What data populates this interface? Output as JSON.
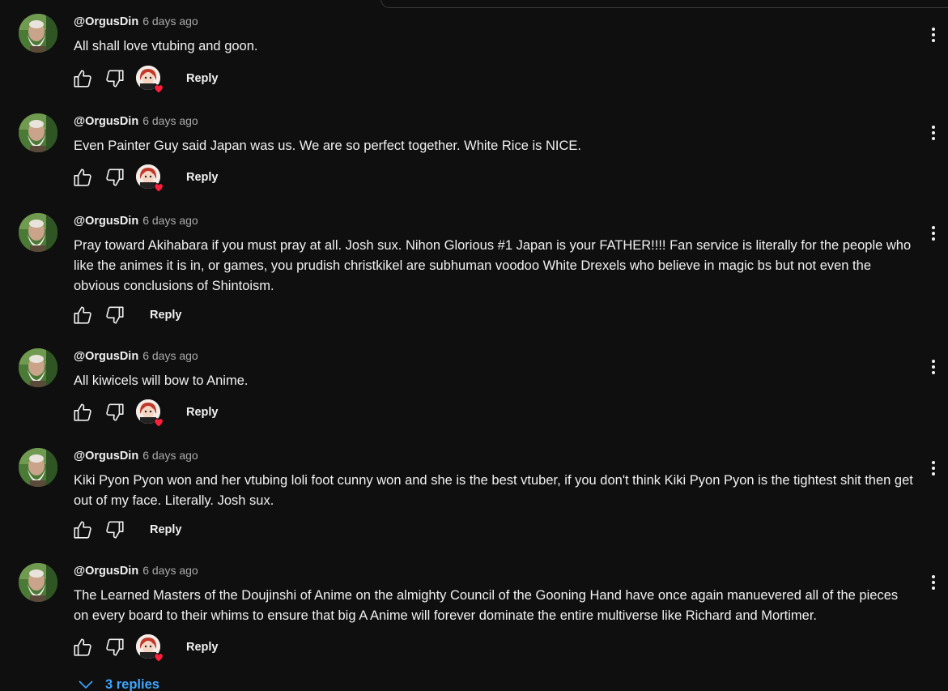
{
  "comments": [
    {
      "author": "@OrgusDin",
      "time": "6 days ago",
      "text": "All shall love vtubing and goon.",
      "reply_label": "Reply",
      "creator_hearted": true
    },
    {
      "author": "@OrgusDin",
      "time": "6 days ago",
      "text": "Even Painter Guy said Japan was us. We are so perfect together. White Rice is NICE.",
      "reply_label": "Reply",
      "creator_hearted": true
    },
    {
      "author": "@OrgusDin",
      "time": "6 days ago",
      "text": "Pray toward Akihabara if you must pray at all. Josh sux. Nihon Glorious #1 Japan is your FATHER!!!! Fan service is literally for the people who like the animes it is in, or games, you prudish christkikel are subhuman voodoo White Drexels who believe in magic bs but not even the obvious conclusions of Shintoism.",
      "reply_label": "Reply",
      "creator_hearted": false
    },
    {
      "author": "@OrgusDin",
      "time": "6 days ago",
      "text": "All kiwicels will bow to Anime.",
      "reply_label": "Reply",
      "creator_hearted": true
    },
    {
      "author": "@OrgusDin",
      "time": "6 days ago",
      "text": "Kiki Pyon Pyon won and her vtubing loli foot cunny won and she is the best vtuber, if you don't think Kiki Pyon Pyon is the tightest shit then get out of my face. Literally. Josh sux.",
      "reply_label": "Reply",
      "creator_hearted": false
    },
    {
      "author": "@OrgusDin",
      "time": "6 days ago",
      "text": "The Learned Masters of the Doujinshi of Anime on the almighty Council of the Gooning Hand have once again manuevered all of the pieces on every board to their whims to ensure that big A Anime will forever dominate the entire multiverse like Richard and Mortimer.",
      "reply_label": "Reply",
      "creator_hearted": true
    }
  ],
  "replies_toggle": {
    "label": "3 replies"
  },
  "colors": {
    "background": "#0f0f0f",
    "text": "#f1f1f1",
    "secondary_text": "#aaaaaa",
    "link_blue": "#3ea6ff",
    "heart_red": "#ff1e3c"
  },
  "icons": {
    "like": "thumbs-up-icon",
    "dislike": "thumbs-down-icon",
    "heart": "heart-icon",
    "more": "more-vert-icon",
    "chevron": "chevron-down-icon"
  }
}
